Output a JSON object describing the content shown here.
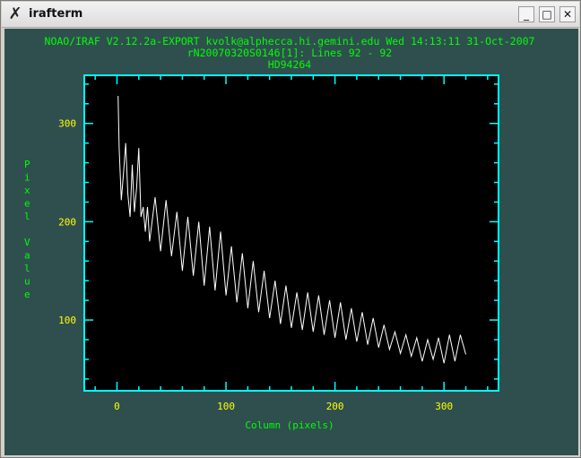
{
  "window": {
    "title": "irafterm",
    "app_icon": "x-logo-icon",
    "buttons": [
      {
        "name": "minimize-button",
        "label": "_"
      },
      {
        "name": "maximize-button",
        "label": "□"
      },
      {
        "name": "close-button",
        "label": "✕"
      }
    ]
  },
  "header": {
    "line1": "NOAO/IRAF V2.12.2a-EXPORT kvolk@alphecca.hi.gemini.edu Wed 14:13:11 31-Oct-2007",
    "line2": "rN20070320S0146[1]: Lines 92 - 92",
    "line3": "HD94264"
  },
  "colors": {
    "background": "#2f4f4f",
    "plot_area": "#000000",
    "frame": "#00ffff",
    "text": "#00ff00",
    "tick_labels": "#ffff00",
    "trace": "#ffffff"
  },
  "chart_data": {
    "type": "line",
    "title": "HD94264",
    "xlabel": "Column (pixels)",
    "ylabel": "Pixel Value",
    "xlim": [
      -30,
      350
    ],
    "ylim": [
      28,
      349
    ],
    "xticks": [
      0,
      100,
      200,
      300
    ],
    "yticks": [
      100,
      200,
      300
    ],
    "grid": false,
    "series": [
      {
        "x": [
          1,
          2,
          4,
          6,
          8,
          10,
          12,
          14,
          16,
          18,
          20,
          22,
          24,
          26,
          28,
          30,
          35,
          40,
          45,
          50,
          55,
          60,
          65,
          70,
          75,
          80,
          85,
          90,
          95,
          100,
          105,
          110,
          115,
          120,
          125,
          130,
          135,
          140,
          145,
          150,
          155,
          160,
          165,
          170,
          175,
          180,
          185,
          190,
          195,
          200,
          205,
          210,
          215,
          220,
          225,
          230,
          235,
          240,
          245,
          250,
          255,
          260,
          265,
          270,
          275,
          280,
          285,
          290,
          295,
          300,
          305,
          310,
          315,
          320
        ],
        "y": [
          328,
          275,
          222,
          250,
          280,
          228,
          205,
          258,
          210,
          235,
          275,
          205,
          215,
          190,
          215,
          180,
          225,
          170,
          222,
          165,
          210,
          150,
          205,
          145,
          200,
          135,
          195,
          130,
          190,
          125,
          175,
          118,
          168,
          112,
          160,
          108,
          150,
          102,
          140,
          96,
          135,
          92,
          128,
          90,
          128,
          88,
          125,
          85,
          120,
          82,
          118,
          80,
          112,
          78,
          108,
          75,
          102,
          72,
          95,
          70,
          88,
          66,
          85,
          63,
          82,
          58,
          80,
          60,
          82,
          56,
          85,
          58,
          85,
          65
        ]
      }
    ]
  }
}
